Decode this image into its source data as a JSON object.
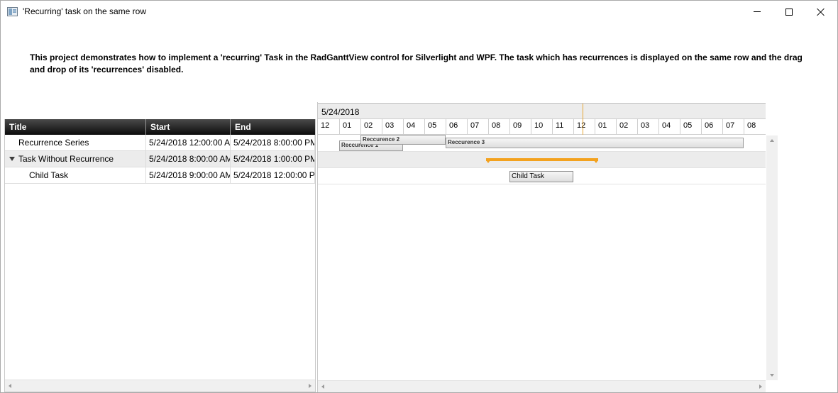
{
  "window": {
    "title": "'Recurring' task on the same row",
    "description": "This project demonstrates how to implement a 'recurring' Task in the RadGanttView control for Silverlight and WPF. The task which has recurrences is displayed on the same row and the drag and drop of its 'recurrences' disabled."
  },
  "grid": {
    "columns": [
      "Title",
      "Start",
      "End"
    ],
    "rows": [
      {
        "title": "Recurrence Series",
        "start": "5/24/2018 12:00:00 A",
        "end": "5/24/2018 8:00:00 PM"
      },
      {
        "title": "Task Without Recurrence",
        "start": "5/24/2018 8:00:00 AM",
        "end": "5/24/2018 1:00:00 PM"
      },
      {
        "title": "Child Task",
        "start": "5/24/2018 9:00:00 AM",
        "end": "5/24/2018 12:00:00 P"
      }
    ]
  },
  "timeline": {
    "date": "5/24/2018",
    "hours": [
      "12",
      "01",
      "02",
      "03",
      "04",
      "05",
      "06",
      "07",
      "08",
      "09",
      "10",
      "11",
      "12",
      "01",
      "02",
      "03",
      "04",
      "05",
      "06",
      "07",
      "08"
    ],
    "recurrences": [
      {
        "label": "Reccurence 1"
      },
      {
        "label": "Reccurence 2"
      },
      {
        "label": "Reccurence 3"
      }
    ],
    "child_task_label": "Child Task",
    "summary_color": "#f3a21f",
    "today_line_color": "#e8a838"
  }
}
